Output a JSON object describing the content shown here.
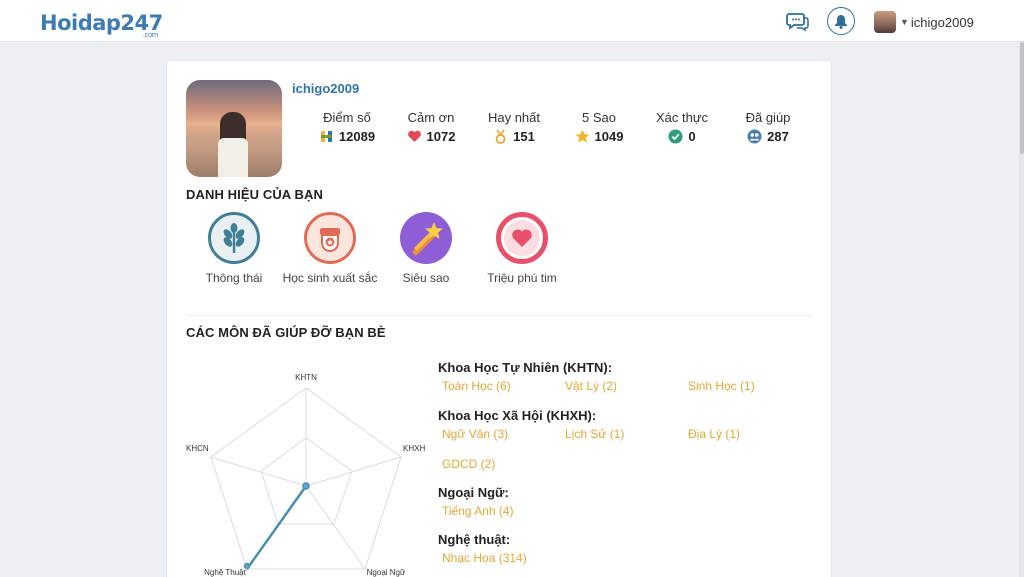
{
  "header": {
    "logo_text": "Hoidap247",
    "logo_sub": ".com",
    "username": "ichigo2009"
  },
  "profile": {
    "name": "ichigo2009",
    "stats": [
      {
        "label": "Điểm số",
        "value": "12089",
        "icon": "points-icon"
      },
      {
        "label": "Cảm ơn",
        "value": "1072",
        "icon": "heart-icon"
      },
      {
        "label": "Hay nhất",
        "value": "151",
        "icon": "medal-icon"
      },
      {
        "label": "5 Sao",
        "value": "1049",
        "icon": "star-icon"
      },
      {
        "label": "Xác thực",
        "value": "0",
        "icon": "verified-icon"
      },
      {
        "label": "Đã giúp",
        "value": "287",
        "icon": "helped-users-icon"
      }
    ]
  },
  "titles": {
    "heading": "DANH HIỆU CỦA BẠN",
    "badges": [
      {
        "label": "Thông thái",
        "icon": "wheat-icon"
      },
      {
        "label": "Học sinh xuất sắc",
        "icon": "student-badge-icon"
      },
      {
        "label": "Siêu sao",
        "icon": "shooting-star-icon"
      },
      {
        "label": "Triệu phú tim",
        "icon": "heart-badge-icon"
      }
    ]
  },
  "subjects": {
    "heading": "CÁC MÔN ĐÃ GIÚP ĐỠ BẠN BÈ",
    "radar_axes": [
      "KHTN",
      "KHXH",
      "Ngoại Ngữ",
      "Nghệ Thuật",
      "KHCN"
    ],
    "groups": [
      {
        "name": "Khoa Học Tự Nhiên (KHTN):",
        "items": [
          "Toán Học (6)",
          "Vật Lý (2)",
          "Sinh Học (1)"
        ]
      },
      {
        "name": "Khoa Học Xã Hội (KHXH):",
        "items": [
          "Ngữ Văn (3)",
          "Lịch Sử (1)",
          "Địa Lý (1)",
          "GDCD (2)"
        ]
      },
      {
        "name": "Ngoại Ngữ:",
        "items": [
          "Tiếng Anh (4)"
        ]
      },
      {
        "name": "Nghệ thuật:",
        "items": [
          "Nhạc Họa (314)"
        ]
      }
    ]
  },
  "colors": {
    "brand_blue": "#2f74a8",
    "subject_item": "#e0a939",
    "radar_line": "#4a8db0"
  }
}
